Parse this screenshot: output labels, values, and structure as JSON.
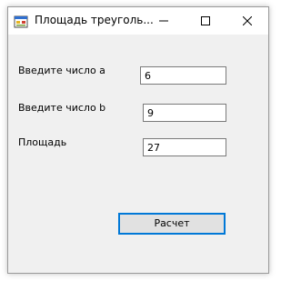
{
  "window": {
    "title": "Площадь треуголь...",
    "icon": "form-icon",
    "controls": {
      "minimize": "minimize-icon",
      "maximize": "maximize-icon",
      "close": "close-icon"
    }
  },
  "form": {
    "label_a": "Введите число a",
    "value_a": "6",
    "label_b": "Введите число b",
    "value_b": "9",
    "label_area": "Площадь",
    "value_area": "27"
  },
  "actions": {
    "calculate_label": "Расчет"
  },
  "colors": {
    "client_bg": "#f0f0f0",
    "titlebar_bg": "#ffffff",
    "focus_border": "#0078d7",
    "button_bg": "#e1e1e1"
  }
}
